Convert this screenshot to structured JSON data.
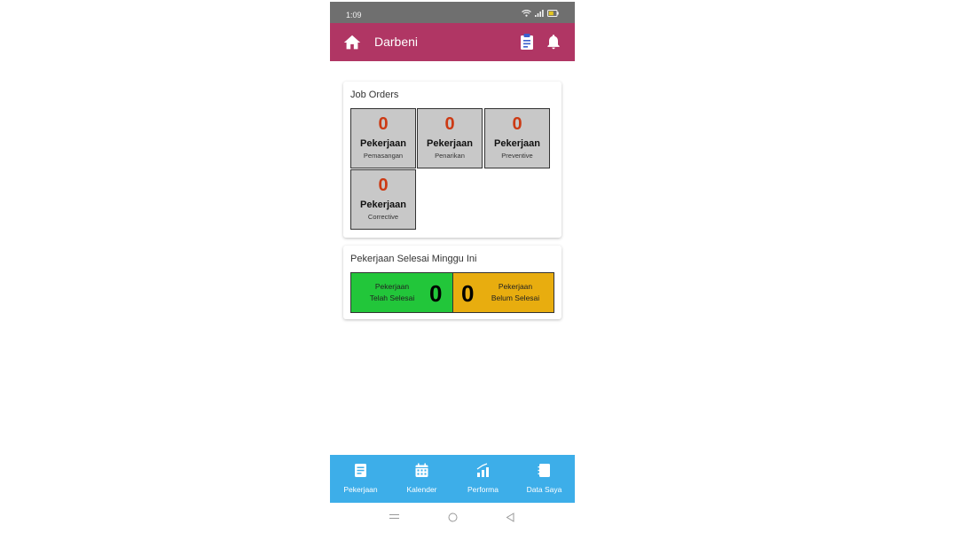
{
  "status_bar": {
    "time": "1:09"
  },
  "app_bar": {
    "title": "Darbeni"
  },
  "job_orders": {
    "title": "Job Orders",
    "tiles": [
      {
        "count": "0",
        "label": "Pekerjaan",
        "sub": "Pemasangan"
      },
      {
        "count": "0",
        "label": "Pekerjaan",
        "sub": "Penarikan"
      },
      {
        "count": "0",
        "label": "Pekerjaan",
        "sub": "Preventive"
      },
      {
        "count": "0",
        "label": "Pekerjaan",
        "sub": "Corrective"
      }
    ]
  },
  "weekly": {
    "title": "Pekerjaan Selesai Minggu Ini",
    "done": {
      "label_line1": "Pekerjaan",
      "label_line2": "Telah Selesai",
      "count": "0",
      "color": "#22c63a"
    },
    "pending": {
      "label_line1": "Pekerjaan",
      "label_line2": "Belum Selesai",
      "count": "0",
      "color": "#e8ad0f"
    }
  },
  "bottom_nav": [
    {
      "label": "Pekerjaan",
      "icon": "document-icon"
    },
    {
      "label": "Kalender",
      "icon": "calendar-icon"
    },
    {
      "label": "Performa",
      "icon": "chart-icon"
    },
    {
      "label": "Data Saya",
      "icon": "notebook-icon"
    }
  ],
  "colors": {
    "app_bar": "#b03664",
    "bottom_nav": "#3daee9",
    "count": "#cc3a14",
    "tile": "#c8c8c8"
  }
}
